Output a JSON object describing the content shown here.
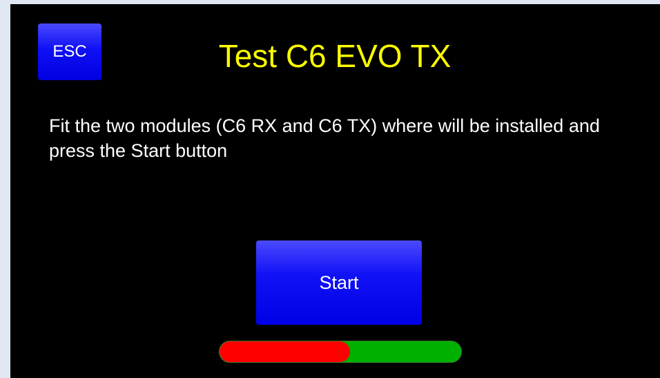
{
  "dialog": {
    "title": "Test C6 EVO TX",
    "message": "Fit the two modules (C6 RX and C6 TX) where will be installed and press the Start button"
  },
  "buttons": {
    "esc_label": "ESC",
    "start_label": "Start"
  },
  "progress": {
    "fraction": 0.54
  },
  "colors": {
    "background": "#000000",
    "title": "#ffff00",
    "text": "#ffffff",
    "button": "#1010f5",
    "progress_fill": "#ff0000",
    "progress_track": "#00b000",
    "outer_frame": "#dfe8f2"
  }
}
